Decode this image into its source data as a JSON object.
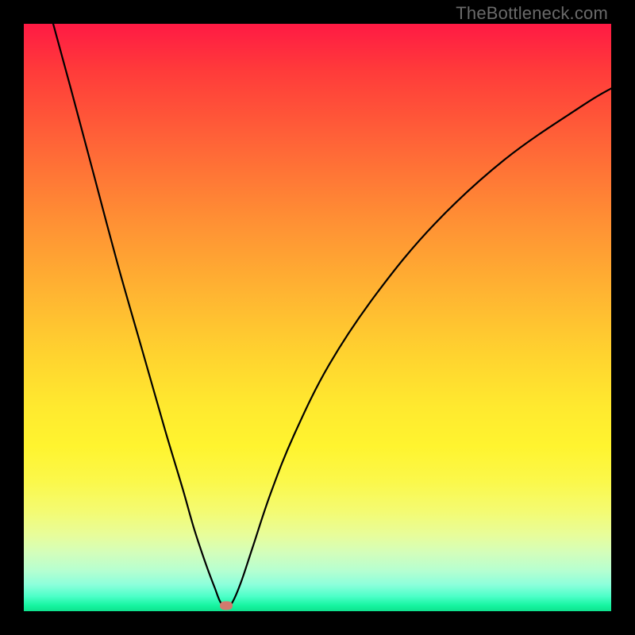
{
  "watermark": "TheBottleneck.com",
  "colors": {
    "frame": "#000000",
    "curve_stroke": "#000000",
    "marker_fill": "#d27a6e"
  },
  "chart_data": {
    "type": "line",
    "title": "",
    "xlabel": "",
    "ylabel": "",
    "xlim": [
      0,
      100
    ],
    "ylim": [
      0,
      100
    ],
    "annotations": {
      "background": "red-to-green vertical gradient (bottleneck severity)",
      "minimum_marker": {
        "x": 34.5,
        "y_pct_from_top": 99
      }
    },
    "series": [
      {
        "name": "bottleneck-curve",
        "note": "y is percent from top of plot area (0 = top, 100 = bottom)",
        "x": [
          5,
          8,
          12,
          16,
          20,
          24,
          27,
          29,
          31,
          32.5,
          33.5,
          34.5,
          35.5,
          37,
          39,
          42,
          46,
          52,
          60,
          70,
          82,
          95,
          100
        ],
        "y_pct_from_top": [
          0,
          11,
          26,
          41,
          55,
          69,
          79,
          86,
          92,
          96,
          98.5,
          99.2,
          98.5,
          95,
          89,
          80,
          70,
          58,
          46,
          34,
          23,
          14,
          11
        ]
      }
    ]
  }
}
